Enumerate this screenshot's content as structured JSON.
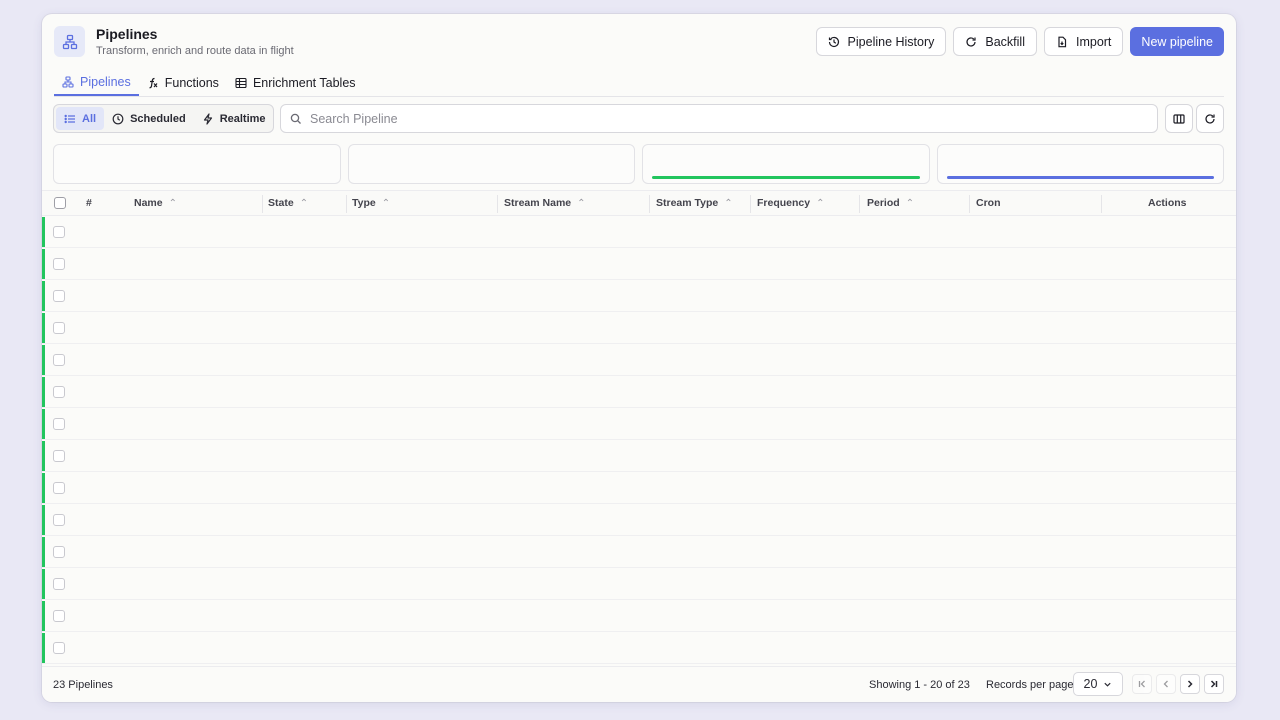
{
  "header": {
    "title": "Pipelines",
    "subtitle": "Transform, enrich and route data in flight",
    "buttons": {
      "history": "Pipeline History",
      "backfill": "Backfill",
      "import": "Import",
      "new": "New pipeline"
    }
  },
  "tabs": [
    {
      "label": "Pipelines",
      "active": true
    },
    {
      "label": "Functions",
      "active": false
    },
    {
      "label": "Enrichment Tables",
      "active": false
    }
  ],
  "filters": {
    "all": "All",
    "scheduled": "Scheduled",
    "realtime": "Realtime",
    "selected": "All"
  },
  "search": {
    "placeholder": "Search Pipeline",
    "value": ""
  },
  "stat_cards": {
    "accent_green": "#22c55e",
    "accent_indigo": "#5b6fe0"
  },
  "table": {
    "columns": [
      "#",
      "Name",
      "State",
      "Type",
      "Stream Name",
      "Stream Type",
      "Frequency",
      "Period",
      "Cron",
      "Actions"
    ],
    "row_count": 14,
    "row_accent_color": "#22c55e"
  },
  "footer": {
    "count": "23 Pipelines",
    "showing": "Showing 1 - 20 of 23",
    "records_per_page_label": "Records per page",
    "records_per_page": "20"
  },
  "colors": {
    "primary": "#5b6fe0",
    "success": "#22c55e",
    "background": "#e9e8f5"
  }
}
